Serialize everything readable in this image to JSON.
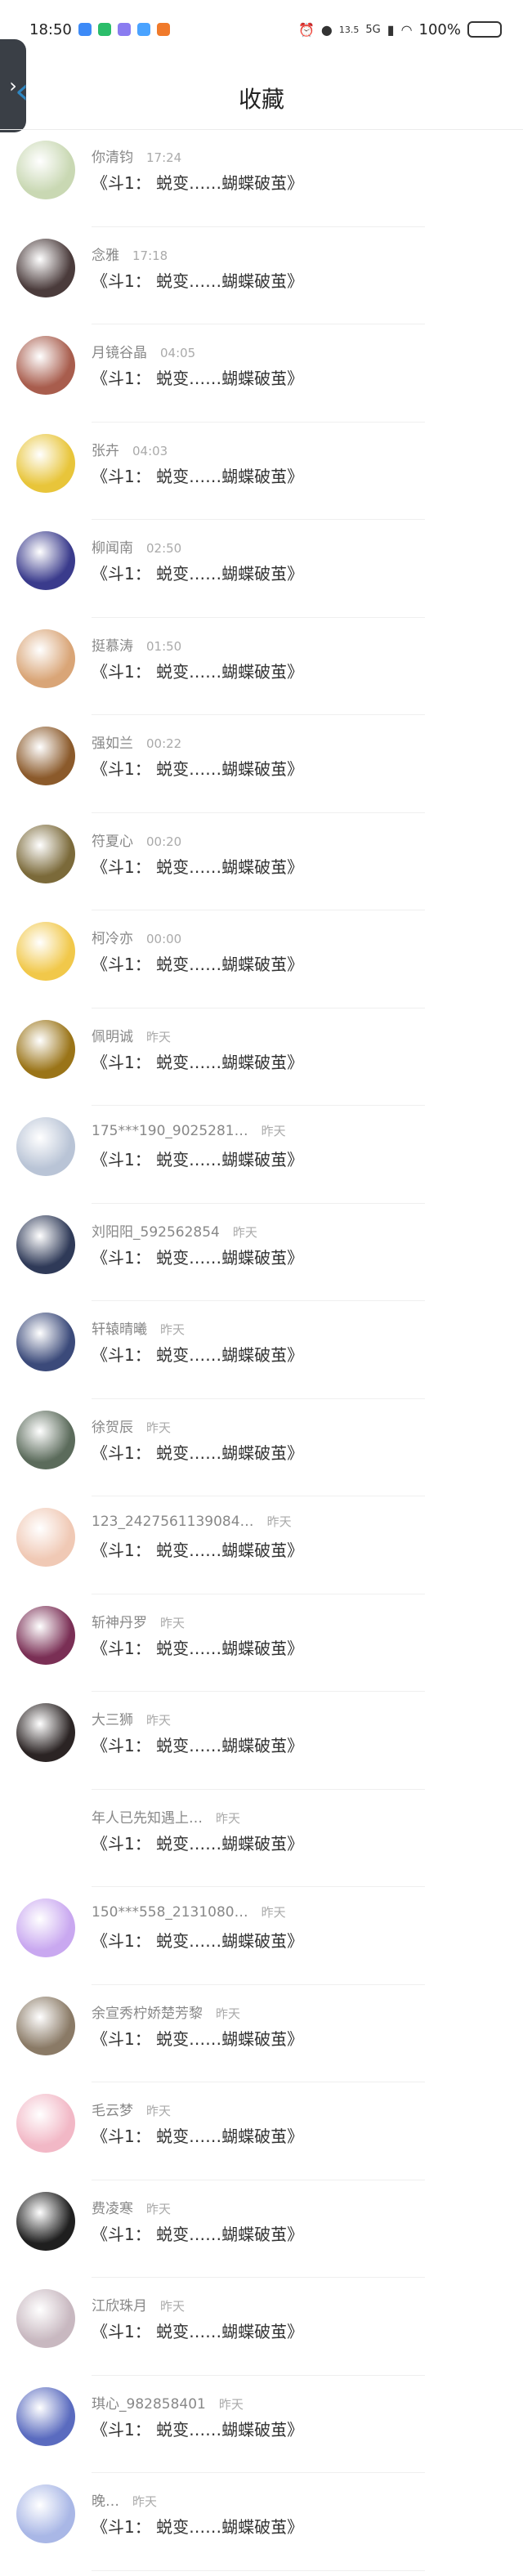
{
  "status": {
    "time": "18:50",
    "speed": "13.5",
    "network": "5G",
    "battery": "100%"
  },
  "header": {
    "title": "收藏",
    "side_tab": "›"
  },
  "items": [
    {
      "name": "你清钧",
      "time": "17:24",
      "message": "《斗1： 蜕变……蝴蝶破茧》",
      "color": "#c9d8b3"
    },
    {
      "name": "念雅",
      "time": "17:18",
      "message": "《斗1： 蜕变……蝴蝶破茧》",
      "color": "#4a3b3b"
    },
    {
      "name": "月镜谷晶",
      "time": "04:05",
      "message": "《斗1： 蜕变……蝴蝶破茧》",
      "color": "#a85d4d"
    },
    {
      "name": "张卉",
      "time": "04:03",
      "message": "《斗1： 蜕变……蝴蝶破茧》",
      "color": "#e8c53a"
    },
    {
      "name": "柳闻南",
      "time": "02:50",
      "message": "《斗1： 蜕变……蝴蝶破茧》",
      "color": "#3a3b8c"
    },
    {
      "name": "挺慕涛",
      "time": "01:50",
      "message": "《斗1： 蜕变……蝴蝶破茧》",
      "color": "#d9a577"
    },
    {
      "name": "强如兰",
      "time": "00:22",
      "message": "《斗1： 蜕变……蝴蝶破茧》",
      "color": "#8b5a2b"
    },
    {
      "name": "符夏心",
      "time": "00:20",
      "message": "《斗1： 蜕变……蝴蝶破茧》",
      "color": "#7b6a3a"
    },
    {
      "name": "柯冷亦",
      "time": "00:00",
      "message": "《斗1： 蜕变……蝴蝶破茧》",
      "color": "#f1c84a"
    },
    {
      "name": "佩明诚",
      "time": "昨天",
      "message": "《斗1： 蜕变……蝴蝶破茧》",
      "color": "#9a7418"
    },
    {
      "name": "175***190_9025281…",
      "time": "昨天",
      "message": "《斗1： 蜕变……蝴蝶破茧》",
      "color": "#b9c4d6"
    },
    {
      "name": "刘阳阳_592562854",
      "time": "昨天",
      "message": "《斗1： 蜕变……蝴蝶破茧》",
      "color": "#2f3a58"
    },
    {
      "name": "轩辕晴曦",
      "time": "昨天",
      "message": "《斗1： 蜕变……蝴蝶破茧》",
      "color": "#3b4a7a"
    },
    {
      "name": "徐贺辰",
      "time": "昨天",
      "message": "《斗1： 蜕变……蝴蝶破茧》",
      "color": "#5b6b5b"
    },
    {
      "name": "123_2427561139084…",
      "time": "昨天",
      "message": "《斗1： 蜕变……蝴蝶破茧》",
      "color": "#f0c9b5"
    },
    {
      "name": "斩神丹罗",
      "time": "昨天",
      "message": "《斗1： 蜕变……蝴蝶破茧》",
      "color": "#7a2f55"
    },
    {
      "name": "大三狮",
      "time": "昨天",
      "message": "《斗1： 蜕变……蝴蝶破茧》",
      "color": "#2b2424"
    },
    {
      "name": "年人已先知遇上…",
      "time": "昨天",
      "message": "《斗1： 蜕变……蝴蝶破茧》",
      "color": "#ffffff"
    },
    {
      "name": "150***558_2131080…",
      "time": "昨天",
      "message": "《斗1： 蜕变……蝴蝶破茧》",
      "color": "#c9a8f0"
    },
    {
      "name": "余宣秀柠娇楚芳黎",
      "time": "昨天",
      "message": "《斗1： 蜕变……蝴蝶破茧》",
      "color": "#8a7a66"
    },
    {
      "name": "毛云梦",
      "time": "昨天",
      "message": "《斗1： 蜕变……蝴蝶破茧》",
      "color": "#f2b8c6"
    },
    {
      "name": "费凌寒",
      "time": "昨天",
      "message": "《斗1： 蜕变……蝴蝶破茧》",
      "color": "#1f1f1f"
    },
    {
      "name": "江欣珠月",
      "time": "昨天",
      "message": "《斗1： 蜕变……蝴蝶破茧》",
      "color": "#c8b8c0"
    },
    {
      "name": "琪心_982858401",
      "time": "昨天",
      "message": "《斗1： 蜕变……蝴蝶破茧》",
      "color": "#5a6bbf"
    },
    {
      "name": "晚…",
      "time": "昨天",
      "message": "《斗1： 蜕变……蝴蝶破茧》",
      "color": "#a9b7e6"
    }
  ]
}
